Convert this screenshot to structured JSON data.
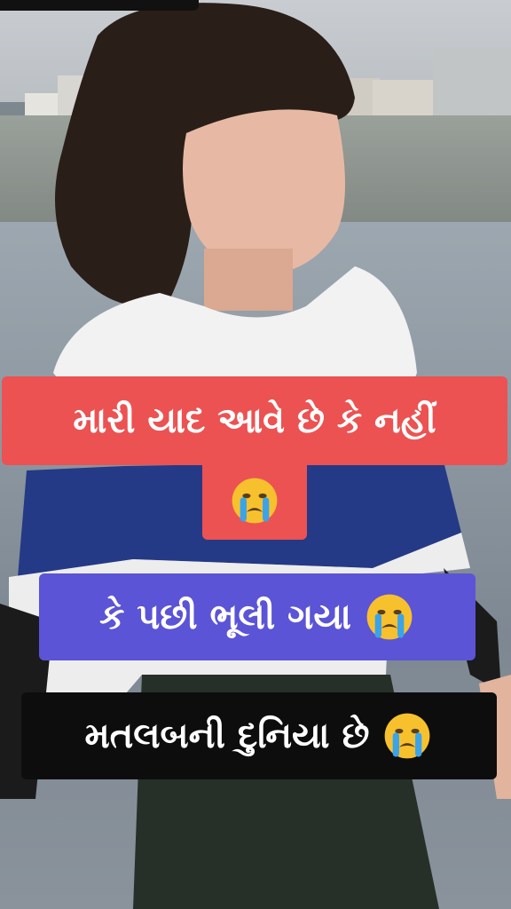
{
  "captions": [
    {
      "text": "મારી યાદ આવે છે કે નહીં",
      "background": "#ec5252"
    },
    {
      "text": "કે પછી ભૂલી ગયા",
      "background": "#5b54d6"
    },
    {
      "text": "મતલબની દુનિયા છે",
      "background": "#0d0d0d"
    }
  ],
  "emoji": "crying-face-emoji",
  "colors": {
    "red": "#ec5252",
    "blue": "#5b54d6",
    "black": "#0d0d0d",
    "text": "#ffffff"
  }
}
